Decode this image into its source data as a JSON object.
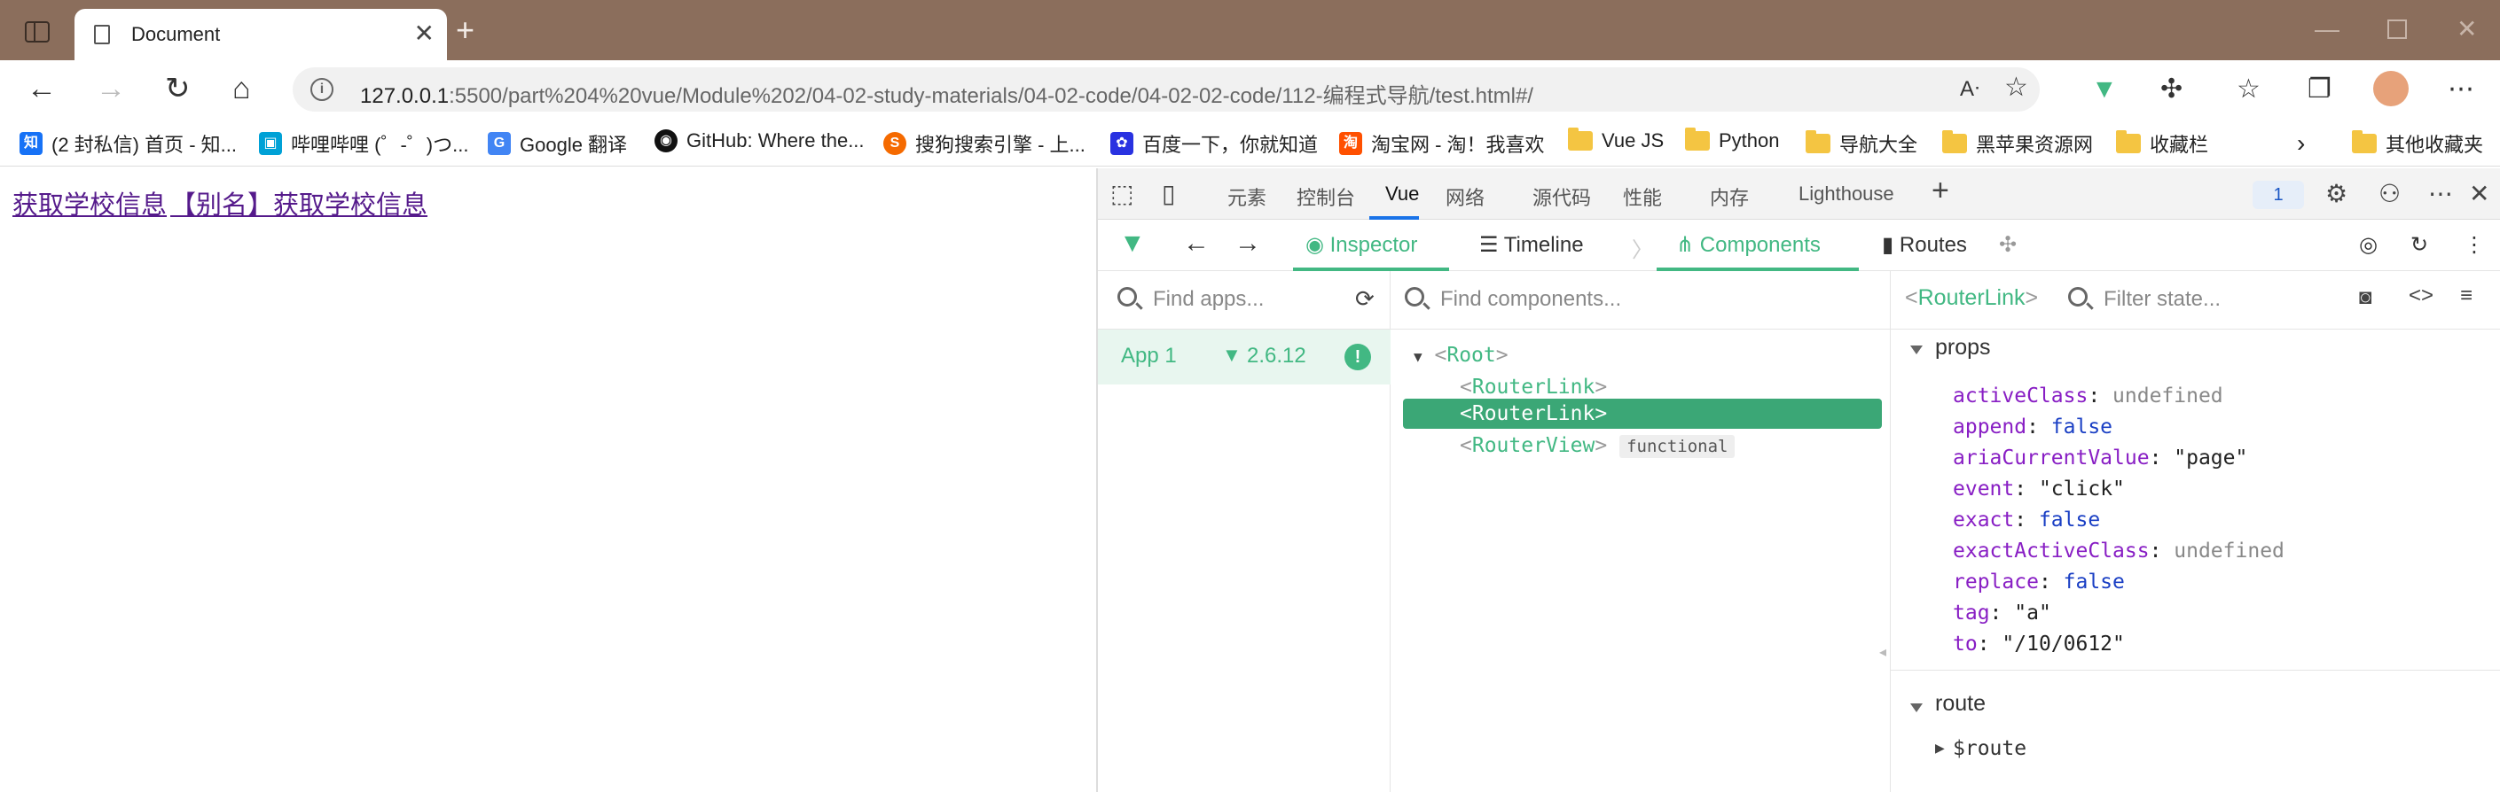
{
  "browser": {
    "tab_title": "Document",
    "url_host": "127.0.0.1",
    "url_rest": ":5500/part%204%20vue/Module%202/04-02-study-materials/04-02-code/04-02-02-code/112-编程式导航/test.html#/"
  },
  "bookmarks": [
    {
      "label": "(2 封私信) 首页 - 知...",
      "icon": "zhihu-icon",
      "color": "#1772f6"
    },
    {
      "label": "哔哩哔哩 (゜-゜)つ...",
      "icon": "bilibili-icon",
      "color": "#00a1d6"
    },
    {
      "label": "Google 翻译",
      "icon": "google-translate-icon",
      "color": "#4285f4"
    },
    {
      "label": "GitHub: Where the...",
      "icon": "github-icon",
      "color": "#111111"
    },
    {
      "label": "搜狗搜索引擎 - 上...",
      "icon": "sogou-icon",
      "color": "#f56a00"
    },
    {
      "label": "百度一下，你就知道",
      "icon": "baidu-icon",
      "color": "#2932e1"
    },
    {
      "label": "淘宝网 - 淘！我喜欢",
      "icon": "taobao-icon",
      "color": "#ff5000"
    },
    {
      "label": "Vue JS",
      "icon": "folder-icon"
    },
    {
      "label": "Python",
      "icon": "folder-icon"
    },
    {
      "label": "导航大全",
      "icon": "folder-icon"
    },
    {
      "label": "黑苹果资源网",
      "icon": "folder-icon"
    },
    {
      "label": "收藏栏",
      "icon": "folder-icon"
    },
    {
      "label": "其他收藏夹",
      "icon": "folder-icon"
    }
  ],
  "page": {
    "link1": "获取学校信息",
    "link2": "【别名】获取学校信息"
  },
  "devtools": {
    "tabs": [
      "元素",
      "控制台",
      "Vue",
      "网络",
      "源代码",
      "性能",
      "内存",
      "Lighthouse"
    ],
    "active_tab": "Vue",
    "issues_count": "1"
  },
  "vue": {
    "inspector": "Inspector",
    "timeline": "Timeline",
    "components": "Components",
    "routes": "Routes",
    "find_apps_placeholder": "Find apps...",
    "find_components_placeholder": "Find components...",
    "filter_state_placeholder": "Filter state...",
    "app_name": "App 1",
    "app_version": "2.6.12",
    "selected_component": "RouterLink",
    "tree": {
      "root": "Root",
      "child1": "RouterLink",
      "child2": "RouterLink",
      "child3": "RouterView",
      "child3_badge": "functional"
    },
    "sections": {
      "props": "props",
      "route": "route",
      "route_item": "$route"
    },
    "props": [
      {
        "key": "activeClass",
        "value": "undefined",
        "kind": "u"
      },
      {
        "key": "append",
        "value": "false",
        "kind": "b"
      },
      {
        "key": "ariaCurrentValue",
        "value": "\"page\"",
        "kind": "s"
      },
      {
        "key": "event",
        "value": "\"click\"",
        "kind": "s"
      },
      {
        "key": "exact",
        "value": "false",
        "kind": "b"
      },
      {
        "key": "exactActiveClass",
        "value": "undefined",
        "kind": "u"
      },
      {
        "key": "replace",
        "value": "false",
        "kind": "b"
      },
      {
        "key": "tag",
        "value": "\"a\"",
        "kind": "s"
      },
      {
        "key": "to",
        "value": "\"/10/0612\"",
        "kind": "s"
      }
    ]
  },
  "colors": {
    "titlebar": "#8b6e5c",
    "vue_green": "#42b883",
    "selected_row": "#3ba776",
    "link": "#551a8b"
  }
}
